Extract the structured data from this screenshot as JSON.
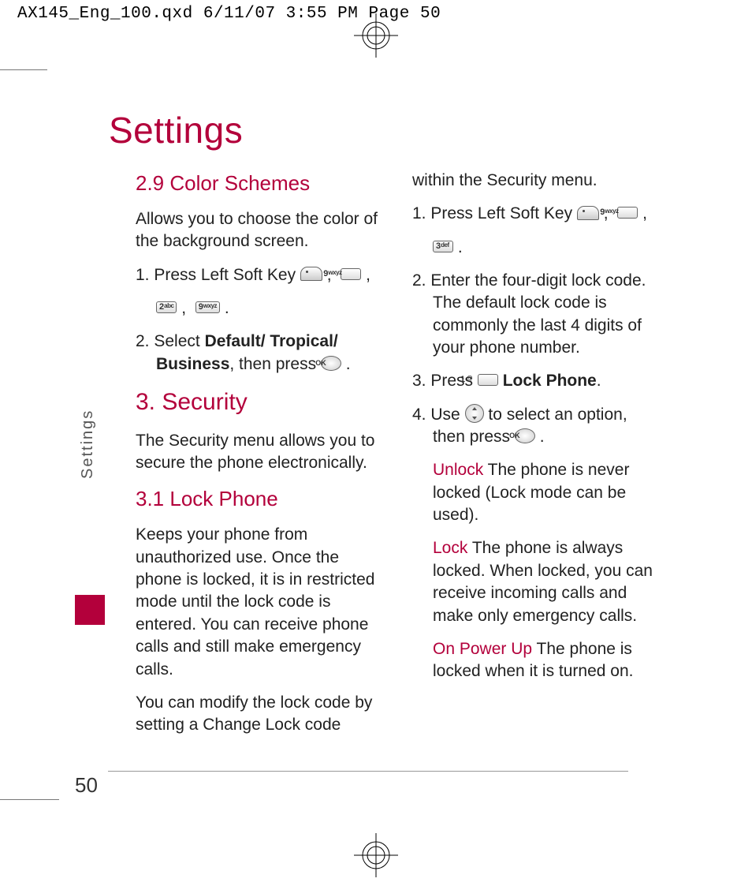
{
  "header_line": "AX145_Eng_100.qxd  6/11/07  3:55 PM  Page 50",
  "page_title": "Settings",
  "side_label": "Settings",
  "page_number": "50",
  "keys": {
    "k9": "9",
    "k9sup": "wxyz",
    "k2": "2",
    "k2sup": "abc",
    "k3": "3",
    "k3sup": "def",
    "k1": "1",
    "ok": "OK"
  },
  "sec": {
    "h29": "2.9 Color Schemes",
    "p29a": "Allows you to choose the color of the background screen.",
    "p29s1a": "1. Press Left Soft Key ",
    "p29s2a": "2. Select ",
    "p29s2b": "Default/ Tropical/ Business",
    "p29s2c": ", then press ",
    "h3": "3. Security",
    "p3a": "The Security menu allows you to secure the phone electronically.",
    "h31": "3.1 Lock Phone",
    "p31a": "Keeps your phone from unauthorized use. Once the phone is locked, it is in restricted mode until the lock code is entered. You can receive phone calls and still make emergency calls.",
    "p31b": "You can modify the lock code by setting a Change Lock code within the Security menu.",
    "rs1a": "1. Press Left Soft Key ",
    "rs2": "2. Enter the four-digit lock code. The default lock code is commonly the last 4 digits of your phone number.",
    "rs3a": "3. Press ",
    "rs3b": " Lock Phone",
    "rs4a": "4. Use ",
    "rs4b": " to select an option, then press ",
    "opt_unlock_t": "Unlock",
    "opt_unlock_d": "  The phone is never locked (Lock mode can be used).",
    "opt_lock_t": "Lock",
    "opt_lock_d": "  The phone is always locked. When locked, you can receive incoming calls and make only emergency calls.",
    "opt_pu_t": "On Power Up",
    "opt_pu_d": "  The phone is locked when it is turned on."
  }
}
